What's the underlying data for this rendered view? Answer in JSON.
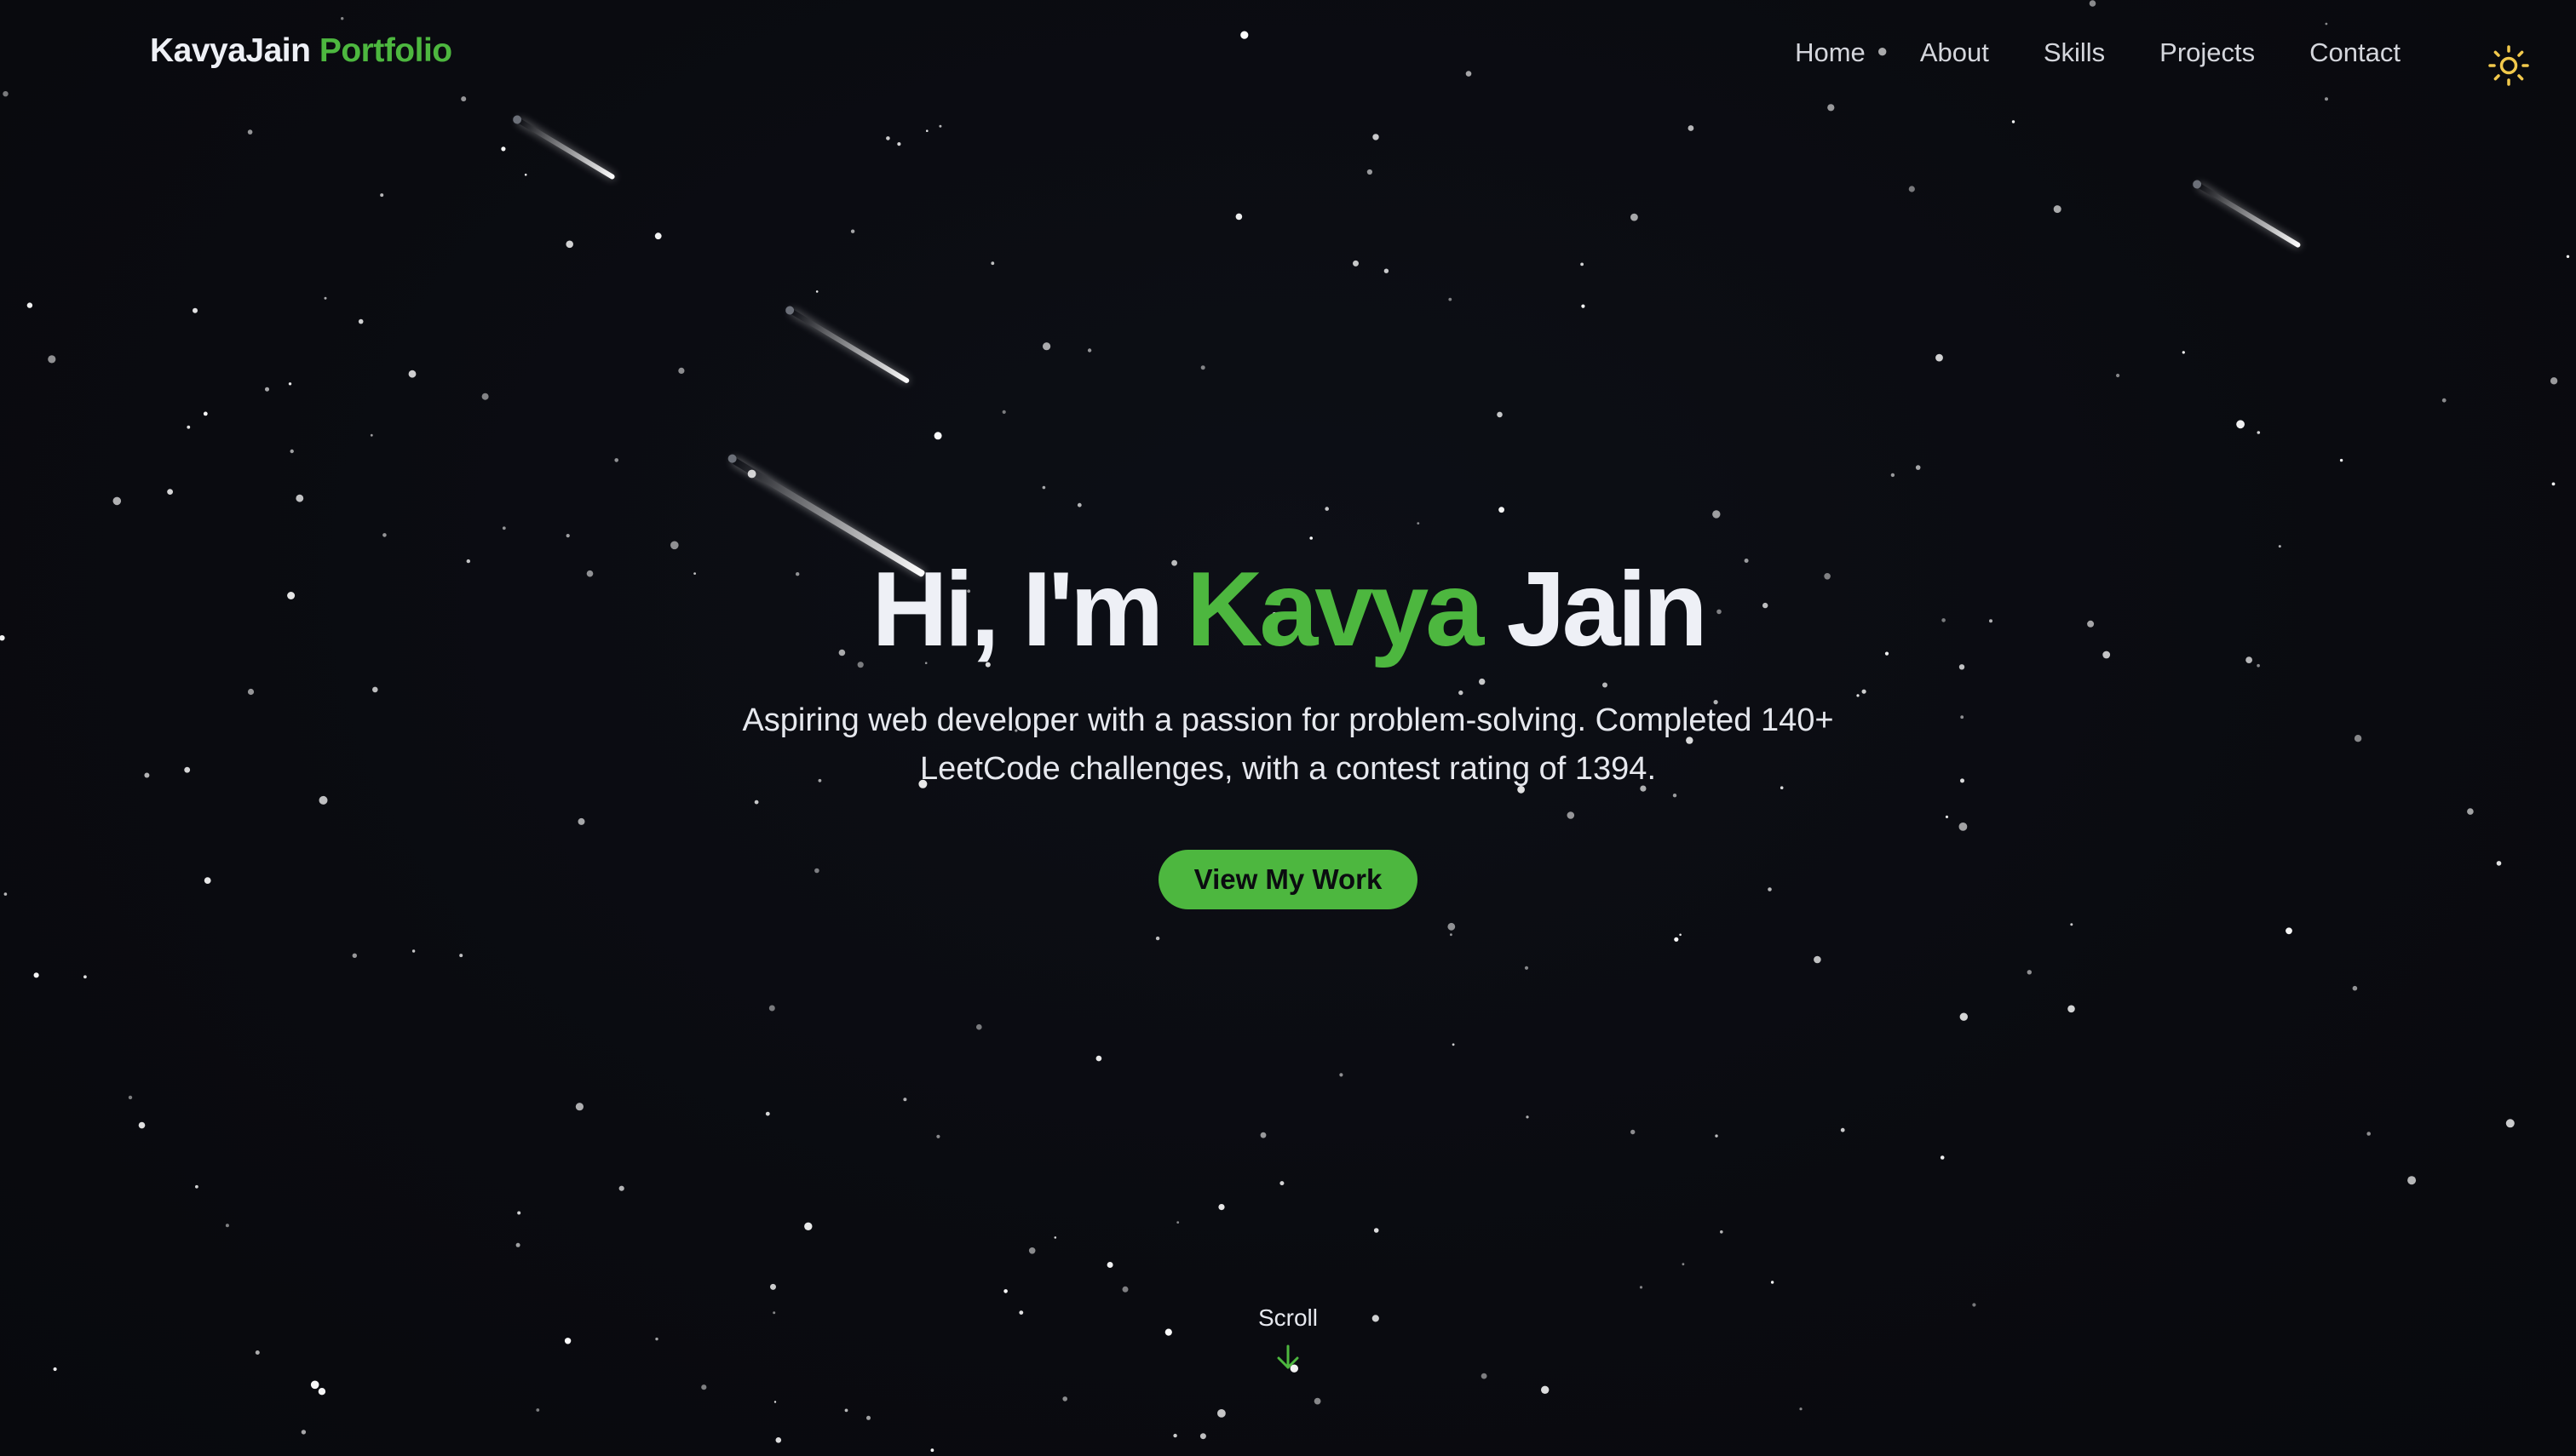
{
  "header": {
    "brand_name": "KavyaJain",
    "brand_accent": "Portfolio",
    "nav": [
      {
        "label": "Home"
      },
      {
        "label": "About"
      },
      {
        "label": "Skills"
      },
      {
        "label": "Projects"
      },
      {
        "label": "Contact"
      }
    ],
    "theme_toggle_icon": "sun-icon"
  },
  "hero": {
    "greeting": "Hi, I'm",
    "first_name": "Kavya",
    "last_name": "Jain",
    "subtitle_line1": "Aspiring web developer with a passion for problem-solving. Completed 140+",
    "subtitle_line2": "LeetCode challenges, with a contest rating of 1394.",
    "cta_label": "View My Work"
  },
  "scroll": {
    "label": "Scroll",
    "icon": "arrow-down-icon"
  },
  "colors": {
    "background": "#0a0b10",
    "accent": "#4db73f",
    "text": "#eef0f6",
    "sun": "#f2c94c"
  }
}
